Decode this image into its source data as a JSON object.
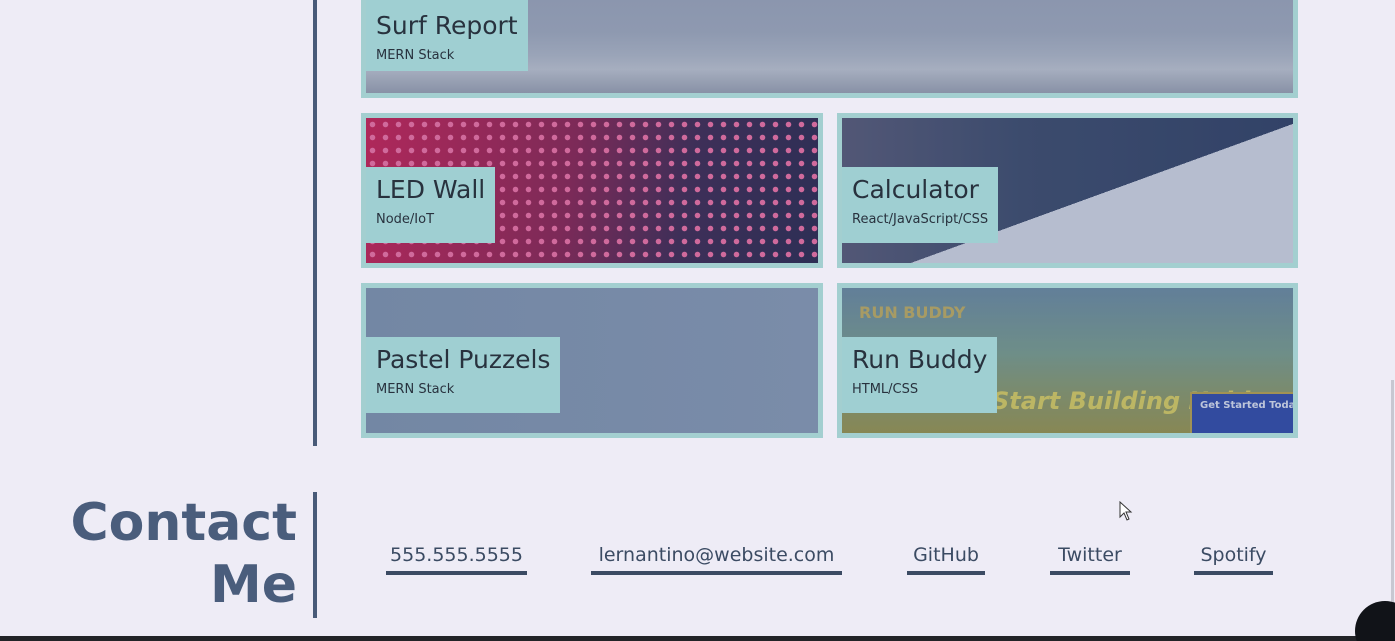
{
  "projects": {
    "surf": {
      "title": "Surf Report",
      "tech": "MERN Stack"
    },
    "led": {
      "title": "LED Wall",
      "tech": "Node/IoT"
    },
    "calc": {
      "title": "Calculator",
      "tech": "React/JavaScript/CSS"
    },
    "pastel": {
      "title": "Pastel Puzzels",
      "tech": "MERN Stack"
    },
    "run": {
      "title": "Run Buddy",
      "tech": "HTML/CSS",
      "preview_logo": "RUN BUDDY",
      "preview_hero": "Start Building Habits",
      "preview_form_title": "Get Started Today"
    }
  },
  "contact": {
    "title_line1": "Contact",
    "title_line2": "Me",
    "links": {
      "phone": "555.555.5555",
      "email": "lernantino@website.com",
      "github": "GitHub",
      "twitter": "Twitter",
      "spotify": "Spotify"
    }
  },
  "colors": {
    "background": "#eeecf6",
    "card_border": "#a3cfd0",
    "label_bg": "#9fcfd2",
    "accent": "#4a5d7c",
    "text_dark": "#28323e"
  }
}
